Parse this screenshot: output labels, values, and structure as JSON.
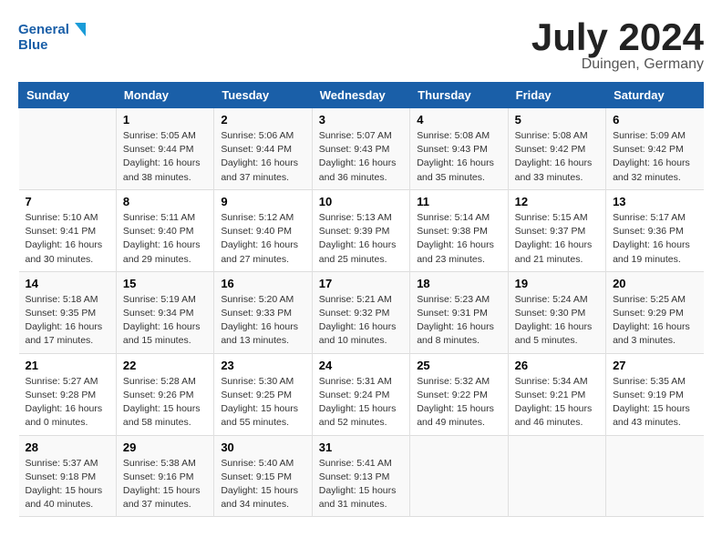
{
  "header": {
    "logo_line1": "General",
    "logo_line2": "Blue",
    "title": "July 2024",
    "subtitle": "Duingen, Germany"
  },
  "columns": [
    "Sunday",
    "Monday",
    "Tuesday",
    "Wednesday",
    "Thursday",
    "Friday",
    "Saturday"
  ],
  "weeks": [
    [
      {
        "day": "",
        "info": ""
      },
      {
        "day": "1",
        "info": "Sunrise: 5:05 AM\nSunset: 9:44 PM\nDaylight: 16 hours\nand 38 minutes."
      },
      {
        "day": "2",
        "info": "Sunrise: 5:06 AM\nSunset: 9:44 PM\nDaylight: 16 hours\nand 37 minutes."
      },
      {
        "day": "3",
        "info": "Sunrise: 5:07 AM\nSunset: 9:43 PM\nDaylight: 16 hours\nand 36 minutes."
      },
      {
        "day": "4",
        "info": "Sunrise: 5:08 AM\nSunset: 9:43 PM\nDaylight: 16 hours\nand 35 minutes."
      },
      {
        "day": "5",
        "info": "Sunrise: 5:08 AM\nSunset: 9:42 PM\nDaylight: 16 hours\nand 33 minutes."
      },
      {
        "day": "6",
        "info": "Sunrise: 5:09 AM\nSunset: 9:42 PM\nDaylight: 16 hours\nand 32 minutes."
      }
    ],
    [
      {
        "day": "7",
        "info": "Sunrise: 5:10 AM\nSunset: 9:41 PM\nDaylight: 16 hours\nand 30 minutes."
      },
      {
        "day": "8",
        "info": "Sunrise: 5:11 AM\nSunset: 9:40 PM\nDaylight: 16 hours\nand 29 minutes."
      },
      {
        "day": "9",
        "info": "Sunrise: 5:12 AM\nSunset: 9:40 PM\nDaylight: 16 hours\nand 27 minutes."
      },
      {
        "day": "10",
        "info": "Sunrise: 5:13 AM\nSunset: 9:39 PM\nDaylight: 16 hours\nand 25 minutes."
      },
      {
        "day": "11",
        "info": "Sunrise: 5:14 AM\nSunset: 9:38 PM\nDaylight: 16 hours\nand 23 minutes."
      },
      {
        "day": "12",
        "info": "Sunrise: 5:15 AM\nSunset: 9:37 PM\nDaylight: 16 hours\nand 21 minutes."
      },
      {
        "day": "13",
        "info": "Sunrise: 5:17 AM\nSunset: 9:36 PM\nDaylight: 16 hours\nand 19 minutes."
      }
    ],
    [
      {
        "day": "14",
        "info": "Sunrise: 5:18 AM\nSunset: 9:35 PM\nDaylight: 16 hours\nand 17 minutes."
      },
      {
        "day": "15",
        "info": "Sunrise: 5:19 AM\nSunset: 9:34 PM\nDaylight: 16 hours\nand 15 minutes."
      },
      {
        "day": "16",
        "info": "Sunrise: 5:20 AM\nSunset: 9:33 PM\nDaylight: 16 hours\nand 13 minutes."
      },
      {
        "day": "17",
        "info": "Sunrise: 5:21 AM\nSunset: 9:32 PM\nDaylight: 16 hours\nand 10 minutes."
      },
      {
        "day": "18",
        "info": "Sunrise: 5:23 AM\nSunset: 9:31 PM\nDaylight: 16 hours\nand 8 minutes."
      },
      {
        "day": "19",
        "info": "Sunrise: 5:24 AM\nSunset: 9:30 PM\nDaylight: 16 hours\nand 5 minutes."
      },
      {
        "day": "20",
        "info": "Sunrise: 5:25 AM\nSunset: 9:29 PM\nDaylight: 16 hours\nand 3 minutes."
      }
    ],
    [
      {
        "day": "21",
        "info": "Sunrise: 5:27 AM\nSunset: 9:28 PM\nDaylight: 16 hours\nand 0 minutes."
      },
      {
        "day": "22",
        "info": "Sunrise: 5:28 AM\nSunset: 9:26 PM\nDaylight: 15 hours\nand 58 minutes."
      },
      {
        "day": "23",
        "info": "Sunrise: 5:30 AM\nSunset: 9:25 PM\nDaylight: 15 hours\nand 55 minutes."
      },
      {
        "day": "24",
        "info": "Sunrise: 5:31 AM\nSunset: 9:24 PM\nDaylight: 15 hours\nand 52 minutes."
      },
      {
        "day": "25",
        "info": "Sunrise: 5:32 AM\nSunset: 9:22 PM\nDaylight: 15 hours\nand 49 minutes."
      },
      {
        "day": "26",
        "info": "Sunrise: 5:34 AM\nSunset: 9:21 PM\nDaylight: 15 hours\nand 46 minutes."
      },
      {
        "day": "27",
        "info": "Sunrise: 5:35 AM\nSunset: 9:19 PM\nDaylight: 15 hours\nand 43 minutes."
      }
    ],
    [
      {
        "day": "28",
        "info": "Sunrise: 5:37 AM\nSunset: 9:18 PM\nDaylight: 15 hours\nand 40 minutes."
      },
      {
        "day": "29",
        "info": "Sunrise: 5:38 AM\nSunset: 9:16 PM\nDaylight: 15 hours\nand 37 minutes."
      },
      {
        "day": "30",
        "info": "Sunrise: 5:40 AM\nSunset: 9:15 PM\nDaylight: 15 hours\nand 34 minutes."
      },
      {
        "day": "31",
        "info": "Sunrise: 5:41 AM\nSunset: 9:13 PM\nDaylight: 15 hours\nand 31 minutes."
      },
      {
        "day": "",
        "info": ""
      },
      {
        "day": "",
        "info": ""
      },
      {
        "day": "",
        "info": ""
      }
    ]
  ]
}
